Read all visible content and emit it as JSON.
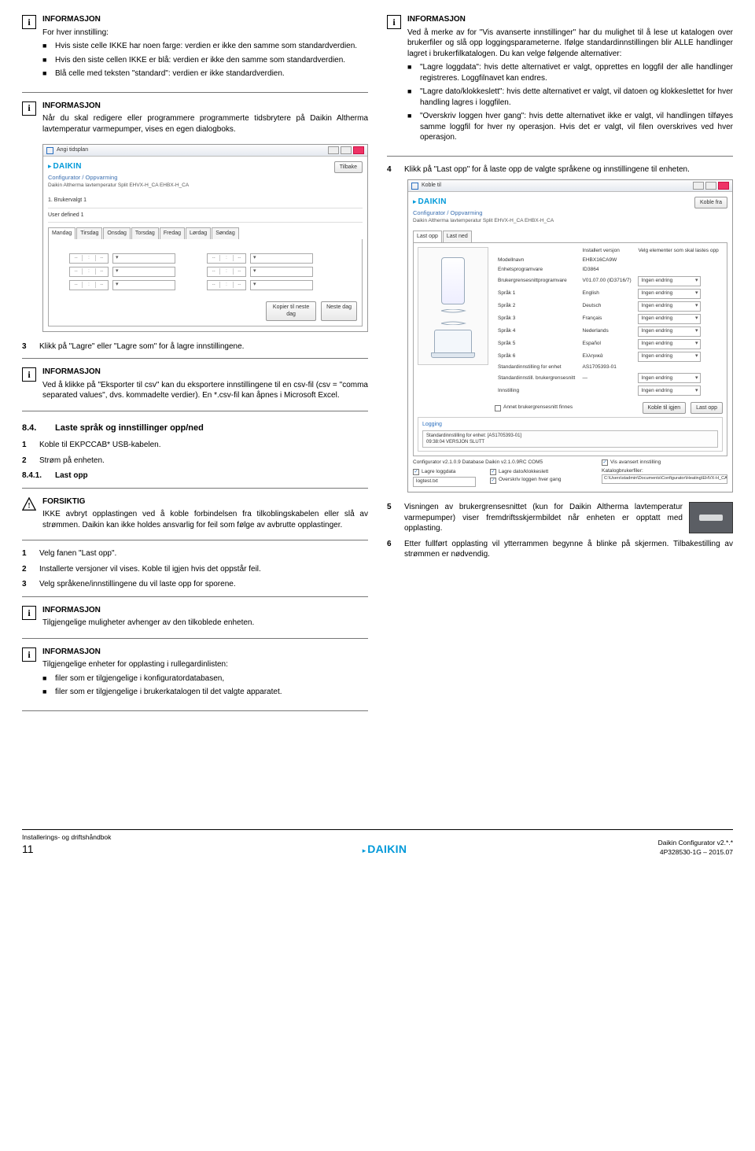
{
  "info_label": "INFORMASJON",
  "caution_label": "FORSIKTIG",
  "left": {
    "info1_intro": "For hver innstilling:",
    "info1_bullets": [
      "Hvis siste celle IKKE har noen farge: verdien er ikke den samme som standardverdien.",
      "Hvis den siste cellen IKKE er blå: verdien er ikke den samme som standardverdien.",
      "Blå celle med teksten \"standard\": verdien er ikke standardverdien."
    ],
    "info2_text": "Når du skal redigere eller programmere programmerte tidsbrytere på Daikin Altherma lavtemperatur varmepumper, vises en egen dialogboks.",
    "mock1": {
      "title": "Angi tidsplan",
      "back": "Tilbake",
      "brand": "DAIKIN",
      "subtitle": "Configurator / Oppvarming",
      "caption": "Daikin Altherma lavtemperatur Split EHVX-H_CA EHBX-H_CA",
      "group1": "1. Brukervalgt 1",
      "userdef": "User defined 1",
      "days": [
        "Mandag",
        "Tirsdag",
        "Onsdag",
        "Torsdag",
        "Fredag",
        "Lørdag",
        "Søndag"
      ],
      "copy_btn": "Kopier til neste dag",
      "next_btn": "Neste dag"
    },
    "step3": "Klikk på \"Lagre\" eller \"Lagre som\" for å lagre innstillingene.",
    "info3_text": "Ved å klikke på \"Eksporter til csv\" kan du eksportere innstillingene til en csv-fil (csv = \"comma separated values\", dvs. kommadelte verdier). En *.csv-fil kan åpnes i Microsoft Excel.",
    "sec84_num": "8.4.",
    "sec84_title": "Laste språk og innstillinger opp/ned",
    "step_a": "Koble til EKPCCAB* USB-kabelen.",
    "step_b": "Strøm på enheten.",
    "sec841_num": "8.4.1.",
    "sec841_title": "Last opp",
    "caution_text": "IKKE avbryt opplastingen ved å koble forbindelsen fra tilkoblingskabelen eller slå av strømmen. Daikin kan ikke holdes ansvarlig for feil som følge av avbrutte opplastinger.",
    "step_c": "Velg fanen \"Last opp\".",
    "step_d": "Installerte versjoner vil vises. Koble til igjen hvis det oppstår feil.",
    "step_e": "Velg språkene/innstillingene du vil laste opp for sporene.",
    "info4_text": "Tilgjengelige muligheter avhenger av den tilkoblede enheten.",
    "info5_intro": "Tilgjengelige enheter for opplasting i rullegardinlisten:",
    "info5_bullets": [
      "filer som er tilgjengelige i konfiguratordatabasen,",
      "filer som er tilgjengelige i brukerkatalogen til det valgte apparatet."
    ]
  },
  "right": {
    "info1_text": "Ved å merke av for \"Vis avanserte innstillinger\" har du mulighet til å lese ut katalogen over brukerfiler og slå opp loggingsparameterne. Ifølge standardinnstillingen blir ALLE handlinger lagret i brukerfilkatalogen. Du kan velge følgende alternativer:",
    "info1_bullets": [
      "\"Lagre loggdata\": hvis dette alternativet er valgt, opprettes en loggfil der alle handlinger registreres. Loggfilnavet kan endres.",
      "\"Lagre dato/klokkeslett\": hvis dette alternativet er valgt, vil datoen og klokkeslettet for hver handling lagres i loggfilen.",
      "\"Overskriv loggen hver gang\": hvis dette alternativet ikke er valgt, vil handlingen tilføyes samme loggfil for hver ny operasjon. Hvis det er valgt, vil filen overskrives ved hver operasjon."
    ],
    "step4": "Klikk på \"Last opp\" for å laste opp de valgte språkene og innstillingene til enheten.",
    "mock2": {
      "title": "Koble til",
      "disconnect": "Koble fra",
      "brand": "DAIKIN",
      "subtitle": "Configurator / Oppvarming",
      "caption": "Daikin Altherma lavtemperatur Split EHVX-H_CA EHBX-H_CA",
      "tab1": "Last opp",
      "tab2": "Last ned",
      "hdr_installed": "Installert versjon",
      "hdr_select": "Velg elementer som skal lastes opp",
      "rows": [
        [
          "Modellnavn",
          "EHBX16CA9W",
          ""
        ],
        [
          "Enhetsprogramvare",
          "ID3864",
          ""
        ],
        [
          "Brukergrensesnittprogramvare",
          "V01.07.00 (ID3716/7)",
          "Ingen endring"
        ],
        [
          "Språk 1",
          "English",
          "Ingen endring"
        ],
        [
          "Språk 2",
          "Deutsch",
          "Ingen endring"
        ],
        [
          "Språk 3",
          "Français",
          "Ingen endring"
        ],
        [
          "Språk 4",
          "Nederlands",
          "Ingen endring"
        ],
        [
          "Språk 5",
          "Español",
          "Ingen endring"
        ],
        [
          "Språk 6",
          "Ελληνικά",
          "Ingen endring"
        ],
        [
          "Standardinnstilling for enhet",
          "AS1705393-01",
          ""
        ],
        [
          "Standardinnstill. brukergrensesnitt",
          "—",
          "Ingen endring"
        ],
        [
          "Innstilling",
          "",
          "Ingen endring"
        ]
      ],
      "other_ui": "Annet brukergrensesnitt finnes",
      "reconnect": "Koble til igjen",
      "upload": "Last opp",
      "logging_title": "Logging",
      "log_line1": "Standardinnstilling for enhet: [AS1705393-01]",
      "log_line2": "09:38:04 VERSJON SLUTT",
      "footer_ver": "Configurator v2.1.0.9  Database Daikin v2.1.0.9RC   COM5",
      "adv_chk": "Vis avansert innstilling",
      "save_log": "Lagre loggdata",
      "save_dt": "Lagre dato/klokkeslett",
      "logfile": "logtest.txt",
      "overwrite": "Overskriv loggen hver gang",
      "catalog_lbl": "Katalogbrukerfiler:",
      "catalog_path": "C:\\Users\\stadmin\\Documents\\Configurator\\Heating\\EHVX-H_CA EHI"
    },
    "step5": "Visningen av brukergrensesnittet (kun for Daikin Altherma lavtemperatur varmepumper) viser fremdriftsskjermbildet når enheten er opptatt med opplasting.",
    "step6": "Etter fullført opplasting vil ytterrammen begynne å blinke på skjermen. Tilbakestilling av strømmen er nødvendig."
  },
  "footer": {
    "left1": "Installerings- og driftshåndbok",
    "page": "11",
    "brand": "DAIKIN",
    "right1": "Daikin Configurator v2.*.*",
    "right2": "4P328530-1G – 2015.07"
  }
}
